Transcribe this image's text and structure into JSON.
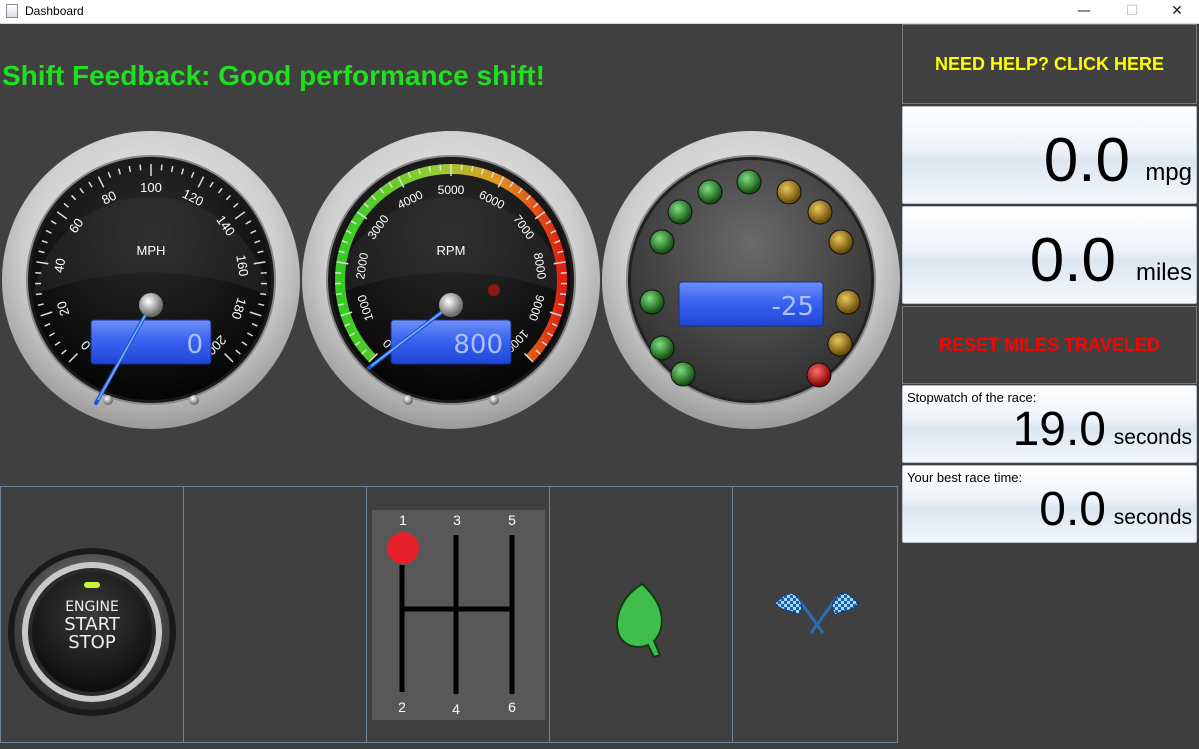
{
  "window": {
    "title": "Dashboard",
    "minimize": "—",
    "maximize": "☐",
    "close": "✕"
  },
  "feedback": "Shift Feedback: Good performance shift!",
  "speedometer": {
    "label": "MPH",
    "value": "0",
    "ticks": [
      "0",
      "20",
      "40",
      "60",
      "80",
      "100",
      "120",
      "140",
      "160",
      "180",
      "200"
    ]
  },
  "tachometer": {
    "label": "RPM",
    "value": "800",
    "ticks": [
      "0",
      "1000",
      "2000",
      "3000",
      "4000",
      "5000",
      "6000",
      "7000",
      "8000",
      "9000",
      "10000"
    ]
  },
  "shift_gauge": {
    "value": "-25"
  },
  "engine_button": {
    "line1": "ENGINE",
    "line2": "START",
    "line3": "STOP"
  },
  "gearbox": {
    "gears": [
      "1",
      "3",
      "5",
      "2",
      "4",
      "6"
    ],
    "current_gear": "1"
  },
  "sidebar": {
    "help_label": "NEED HELP? CLICK HERE",
    "mpg": {
      "value": "0.0",
      "unit": "mpg"
    },
    "miles": {
      "value": "0.0",
      "unit": "miles"
    },
    "reset_label": "RESET MILES TRAVELED",
    "stopwatch": {
      "label": "Stopwatch of the race:",
      "value": "19.0",
      "unit": "seconds"
    },
    "best": {
      "label": "Your best race time:",
      "value": "0.0",
      "unit": "seconds"
    }
  },
  "colors": {
    "feedback": "#1ee01e",
    "help": "#ffff00",
    "reset": "#ff0000",
    "lcd": "#2e5cf0"
  }
}
